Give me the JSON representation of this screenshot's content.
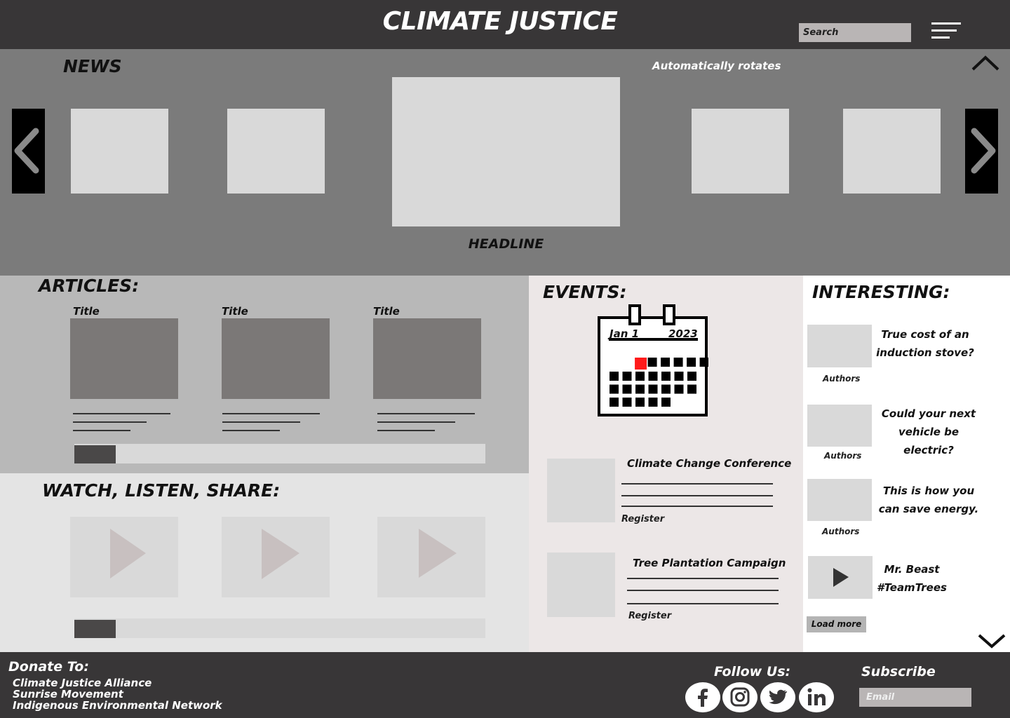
{
  "header": {
    "title": "CLIMATE JUSTICE",
    "search_placeholder": "Search"
  },
  "news": {
    "heading": "NEWS",
    "note": "Automatically rotates",
    "headline": "HEADLINE"
  },
  "articles": {
    "heading": "ARTICLES:",
    "items": [
      {
        "title": "Title"
      },
      {
        "title": "Title"
      },
      {
        "title": "Title"
      }
    ]
  },
  "watch": {
    "heading": "WATCH, LISTEN, SHARE:"
  },
  "events": {
    "heading": "EVENTS:",
    "calendar": {
      "date": "Jan 1",
      "year": "2023",
      "highlight_color": "#ff1a1a"
    },
    "items": [
      {
        "title": "Climate Change Conference",
        "action": "Register"
      },
      {
        "title": "Tree Plantation Campaign",
        "action": "Register"
      }
    ]
  },
  "interesting": {
    "heading": "INTERESTING:",
    "items": [
      {
        "title_line1": "True cost of an",
        "title_line2": "induction stove?",
        "meta": "Authors"
      },
      {
        "title_line1": "Could your next",
        "title_line2": "vehicle be electric?",
        "meta": "Authors"
      },
      {
        "title_line1": "This is how you",
        "title_line2": "can save energy.",
        "meta": "Authors"
      },
      {
        "title_line1": "Mr. Beast",
        "title_line2": "#TeamTrees",
        "meta": ""
      }
    ],
    "load_more": "Load more"
  },
  "footer": {
    "donate_heading": "Donate To:",
    "donate_items": [
      "Climate Justice Alliance",
      "Sunrise Movement",
      "Indigenous Environmental Network"
    ],
    "follow_heading": "Follow Us:",
    "social_icons": [
      "facebook-icon",
      "instagram-icon",
      "twitter-icon",
      "linkedin-icon"
    ],
    "subscribe_heading": "Subscribe",
    "email_placeholder": "Email"
  }
}
